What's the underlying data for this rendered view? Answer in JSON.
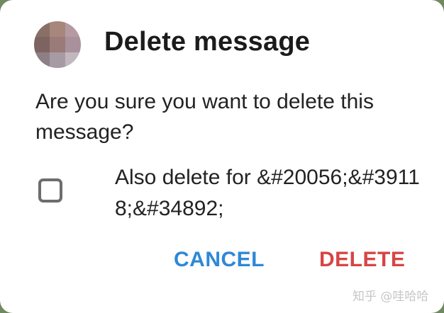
{
  "dialog": {
    "title": "Delete message",
    "message": "Are you sure you want to delete this message?",
    "checkbox": {
      "label": "Also delete for &#20056;&#39118;&#34892;",
      "checked": false
    },
    "buttons": {
      "cancel_label": "CANCEL",
      "delete_label": "DELETE"
    },
    "avatar": {
      "pixel_colors": [
        "#8a6f67",
        "#a7867c",
        "#b59aa1",
        "#7d6461",
        "#9a7b7a",
        "#a8919a",
        "#8d7f84",
        "#a69aa3",
        "#c3b7bf"
      ]
    }
  },
  "colors": {
    "cancel": "#2f88d6",
    "delete": "#d64545",
    "checkbox_border": "#6d6d6d"
  },
  "watermark": {
    "text": "知乎 @哇哈哈"
  }
}
